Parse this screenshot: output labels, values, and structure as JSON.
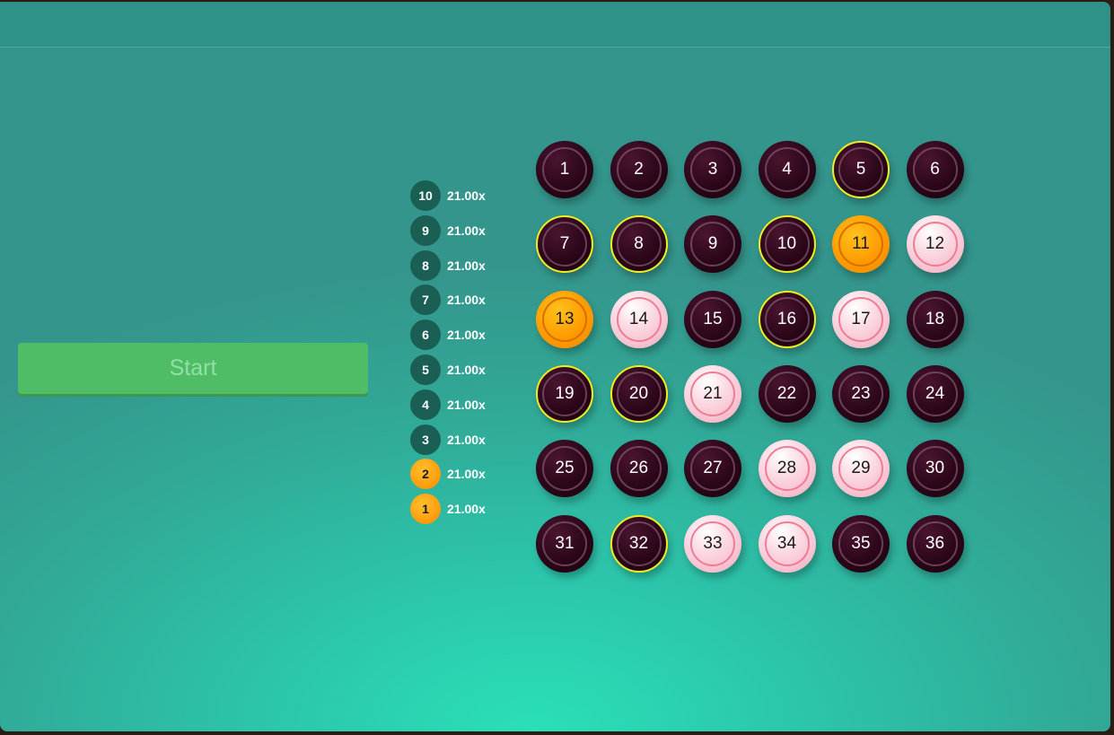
{
  "start_button": {
    "label": "Start"
  },
  "paytable": [
    {
      "hits": "10",
      "multiplier": "21.00x",
      "highlight": false
    },
    {
      "hits": "9",
      "multiplier": "21.00x",
      "highlight": false
    },
    {
      "hits": "8",
      "multiplier": "21.00x",
      "highlight": false
    },
    {
      "hits": "7",
      "multiplier": "21.00x",
      "highlight": false
    },
    {
      "hits": "6",
      "multiplier": "21.00x",
      "highlight": false
    },
    {
      "hits": "5",
      "multiplier": "21.00x",
      "highlight": false
    },
    {
      "hits": "4",
      "multiplier": "21.00x",
      "highlight": false
    },
    {
      "hits": "3",
      "multiplier": "21.00x",
      "highlight": false
    },
    {
      "hits": "2",
      "multiplier": "21.00x",
      "highlight": true
    },
    {
      "hits": "1",
      "multiplier": "21.00x",
      "highlight": true
    }
  ],
  "grid": [
    {
      "n": "1",
      "style": "dark",
      "picked": false
    },
    {
      "n": "2",
      "style": "dark",
      "picked": false
    },
    {
      "n": "3",
      "style": "dark",
      "picked": false
    },
    {
      "n": "4",
      "style": "dark",
      "picked": false
    },
    {
      "n": "5",
      "style": "dark",
      "picked": true
    },
    {
      "n": "6",
      "style": "dark",
      "picked": false
    },
    {
      "n": "7",
      "style": "dark",
      "picked": true
    },
    {
      "n": "8",
      "style": "dark",
      "picked": true
    },
    {
      "n": "9",
      "style": "dark",
      "picked": false
    },
    {
      "n": "10",
      "style": "dark",
      "picked": true
    },
    {
      "n": "11",
      "style": "gold",
      "picked": false
    },
    {
      "n": "12",
      "style": "pink",
      "picked": false
    },
    {
      "n": "13",
      "style": "gold",
      "picked": false
    },
    {
      "n": "14",
      "style": "pink",
      "picked": false
    },
    {
      "n": "15",
      "style": "dark",
      "picked": false
    },
    {
      "n": "16",
      "style": "dark",
      "picked": true
    },
    {
      "n": "17",
      "style": "pink",
      "picked": false
    },
    {
      "n": "18",
      "style": "dark",
      "picked": false
    },
    {
      "n": "19",
      "style": "dark",
      "picked": true
    },
    {
      "n": "20",
      "style": "dark",
      "picked": true
    },
    {
      "n": "21",
      "style": "pink",
      "picked": false
    },
    {
      "n": "22",
      "style": "dark",
      "picked": false
    },
    {
      "n": "23",
      "style": "dark",
      "picked": false
    },
    {
      "n": "24",
      "style": "dark",
      "picked": false
    },
    {
      "n": "25",
      "style": "dark",
      "picked": false
    },
    {
      "n": "26",
      "style": "dark",
      "picked": false
    },
    {
      "n": "27",
      "style": "dark",
      "picked": false
    },
    {
      "n": "28",
      "style": "pink",
      "picked": false
    },
    {
      "n": "29",
      "style": "pink",
      "picked": false
    },
    {
      "n": "30",
      "style": "dark",
      "picked": false
    },
    {
      "n": "31",
      "style": "dark",
      "picked": false
    },
    {
      "n": "32",
      "style": "dark",
      "picked": true
    },
    {
      "n": "33",
      "style": "pink",
      "picked": false
    },
    {
      "n": "34",
      "style": "pink",
      "picked": false
    },
    {
      "n": "35",
      "style": "dark",
      "picked": false
    },
    {
      "n": "36",
      "style": "dark",
      "picked": false
    }
  ],
  "colors": {
    "background": "#2cc4aa",
    "start_button": "#4ebd66",
    "pick_outline": "#f0ee1c",
    "hit_gold": "#ff9a00",
    "paytable_chip": "#1b5f54"
  }
}
